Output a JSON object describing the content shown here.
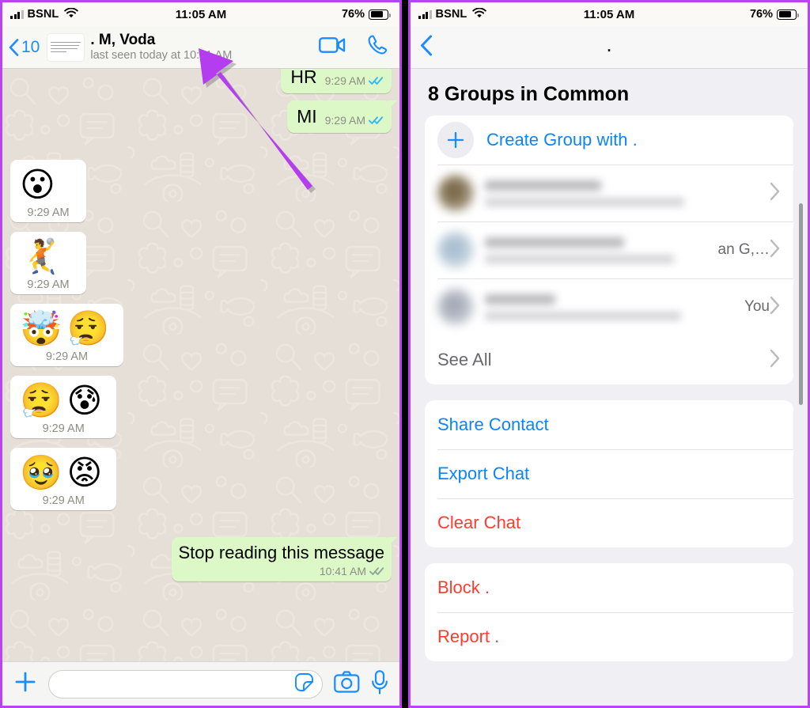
{
  "status_bar": {
    "carrier": "BSNL",
    "time": "11:05 AM",
    "battery_pct": "76%",
    "wifi_icon": "wifi-icon",
    "signal_icon": "signal-bars-icon",
    "battery_icon": "battery-icon"
  },
  "left_screen": {
    "nav": {
      "back_icon": "chevron-left-icon",
      "back_count": "10",
      "avatar_name": "contact-avatar",
      "contact_name": ". M, Voda",
      "last_seen": "last seen today at 10:31 AM",
      "video_call_icon": "video-camera-icon",
      "voice_call_icon": "phone-icon"
    },
    "messages": [
      {
        "id": "msg-hr",
        "side": "out",
        "type": "text",
        "text": "HR",
        "time": "9:29 AM",
        "ticks": "double-check-read-icon",
        "clipped": true
      },
      {
        "id": "msg-mi",
        "side": "out",
        "type": "text",
        "text": "MI",
        "time": "9:29 AM",
        "ticks": "double-check-read-icon",
        "clipped": false
      },
      {
        "id": "msg-e1",
        "side": "in",
        "type": "emoji",
        "emoji": "😮",
        "time": "9:29 AM"
      },
      {
        "id": "msg-e2",
        "side": "in",
        "type": "emoji",
        "emoji": "🤾",
        "time": "9:29 AM"
      },
      {
        "id": "msg-e3",
        "side": "in",
        "type": "emoji",
        "emoji": "🤯😮‍💨",
        "time": "9:29 AM"
      },
      {
        "id": "msg-e4",
        "side": "in",
        "type": "emoji",
        "emoji": "😮‍💨😰",
        "time": "9:29 AM"
      },
      {
        "id": "msg-e5",
        "side": "in",
        "type": "emoji",
        "emoji": "🥹😡",
        "time": "9:29 AM"
      },
      {
        "id": "msg-stop",
        "side": "out",
        "type": "text",
        "text": "Stop reading this message",
        "time": "10:41 AM",
        "ticks": "double-check-read-icon"
      }
    ],
    "input_bar": {
      "plus_icon": "plus-icon",
      "input_value": "",
      "input_placeholder": "",
      "sticker_icon": "sticker-icon",
      "camera_icon": "camera-icon",
      "mic_icon": "microphone-icon"
    }
  },
  "right_screen": {
    "nav": {
      "back_icon": "chevron-left-icon",
      "title": "."
    },
    "groups_section": {
      "heading": "8 Groups in Common",
      "create_group": {
        "icon": "plus-icon",
        "label": "Create Group with ."
      },
      "rows": [
        {
          "id": "group-row-1",
          "name": "",
          "subtitle": "",
          "tail": "",
          "chevron": "chevron-right-icon"
        },
        {
          "id": "group-row-2",
          "name": "",
          "subtitle": "",
          "tail": "an G,…",
          "chevron": "chevron-right-icon"
        },
        {
          "id": "group-row-3",
          "name": "",
          "subtitle": "",
          "tail": "You",
          "chevron": "chevron-right-icon"
        }
      ],
      "see_all": {
        "label": "See All",
        "chevron": "chevron-right-icon"
      }
    },
    "actions": [
      {
        "id": "share-contact",
        "label": "Share Contact",
        "style": "blue"
      },
      {
        "id": "export-chat",
        "label": "Export Chat",
        "style": "blue"
      },
      {
        "id": "clear-chat",
        "label": "Clear Chat",
        "style": "red"
      }
    ],
    "destructive": [
      {
        "id": "block-contact",
        "label": "Block .",
        "style": "red"
      },
      {
        "id": "report-contact",
        "label": "Report .",
        "style": "red"
      }
    ]
  },
  "annotations": {
    "arrow_color": "#b43df0",
    "arrow_1_target": "contact-name-header",
    "arrow_2_target": "clear-chat"
  },
  "colors": {
    "ios_blue": "#0a84ff",
    "ios_red": "#ff3b30",
    "chat_bg": "#e6dfd8",
    "bubble_out": "#dcf8c6",
    "bubble_in": "#ffffff",
    "panel_bg": "#efeff4",
    "frame_purple": "#b845f5"
  }
}
